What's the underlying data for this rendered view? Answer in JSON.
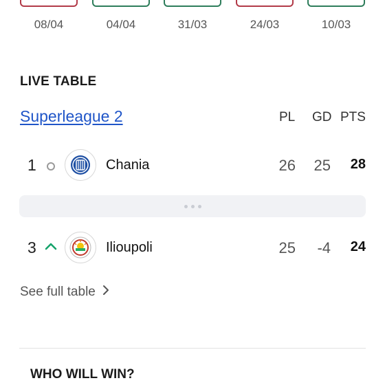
{
  "form": {
    "dates": [
      "08/04",
      "04/04",
      "31/03",
      "24/03",
      "10/03"
    ],
    "box_colors": [
      "#b23a48",
      "#2e7d5b",
      "#2e7d5b",
      "#b23a48",
      "#2e7d5b"
    ]
  },
  "live_table": {
    "title": "LIVE TABLE",
    "league": "Superleague 2",
    "columns": {
      "pl": "PL",
      "gd": "GD",
      "pts": "PTS"
    },
    "rows": [
      {
        "position": "1",
        "trend": "none",
        "team": "Chania",
        "pl": "26",
        "gd": "25",
        "pts": "28",
        "badge_icon": "chania-crest-icon"
      },
      {
        "position": "3",
        "trend": "up",
        "team": "Ilioupoli",
        "pl": "25",
        "gd": "-4",
        "pts": "24",
        "badge_icon": "ilioupoli-crest-icon"
      }
    ],
    "see_full": "See full table"
  },
  "colors": {
    "link": "#1f55c8",
    "trend_up": "#16a36b"
  },
  "who_will_win": {
    "title": "WHO WILL WIN?"
  }
}
